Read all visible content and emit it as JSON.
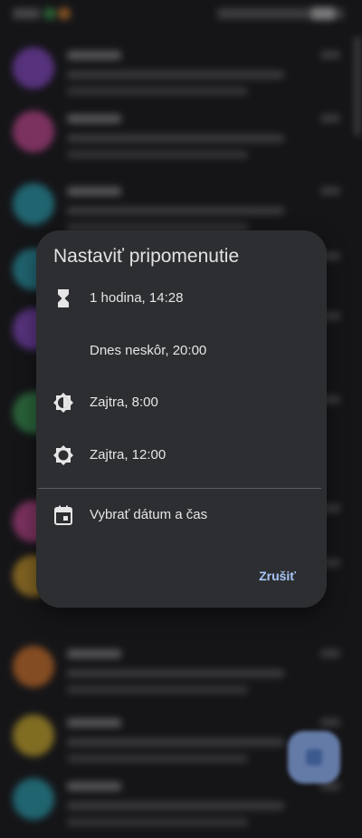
{
  "dialog": {
    "title": "Nastaviť pripomenutie",
    "options": [
      {
        "label": "1 hodina, 14:28",
        "icon": "hourglass-icon"
      },
      {
        "label": "Dnes neskôr, 20:00",
        "icon": "moon-icon"
      },
      {
        "label": "Zajtra, 8:00",
        "icon": "brightness-half-icon"
      },
      {
        "label": "Zajtra, 12:00",
        "icon": "sun-icon"
      }
    ],
    "custom": {
      "label": "Vybrať dátum a čas",
      "icon": "calendar-icon"
    },
    "cancel_label": "Zrušiť"
  },
  "colors": {
    "dialog_bg": "#2d2e31",
    "accent": "#a8c7fa",
    "fab": "#7f9ed8"
  },
  "background_avatars": [
    "#8e4ad0",
    "#d04a9a",
    "#2aa6b8",
    "#2aa6b8",
    "#8e4ad0",
    "#3aa055",
    "#d04a9a",
    "#d9a52b",
    "#e07a2b",
    "#d9b52b",
    "#2aa6b8"
  ]
}
